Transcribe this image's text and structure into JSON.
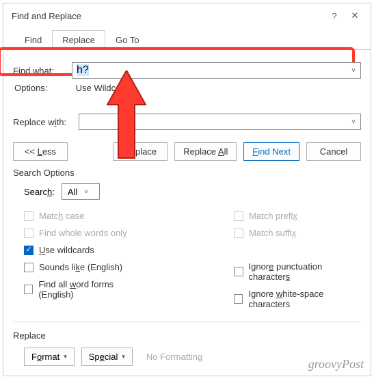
{
  "title": "Find and Replace",
  "tabs": {
    "find": "Find",
    "replace": "Replace",
    "goto": "Go To"
  },
  "fields": {
    "find_label": "Find what:",
    "find_value": "h?",
    "options_label": "Options:",
    "options_value": "Use Wildcards",
    "replace_label": "Replace with:",
    "replace_value": ""
  },
  "buttons": {
    "less": "<< Less",
    "replace": "Replace",
    "replace_all": "Replace All",
    "find_next": "Find Next",
    "cancel": "Cancel"
  },
  "search_options_title": "Search Options",
  "search_label": "Search:",
  "search_value": "All",
  "checks": {
    "match_case": "Match case",
    "whole_words": "Find whole words only",
    "use_wildcards": "Use wildcards",
    "sounds_like": "Sounds like (English)",
    "word_forms": "Find all word forms (English)",
    "match_prefix": "Match prefix",
    "match_suffix": "Match suffix",
    "ignore_punct": "Ignore punctuation characters",
    "ignore_ws": "Ignore white-space characters"
  },
  "replace_section_title": "Replace",
  "bottom": {
    "format": "Format",
    "special": "Special",
    "no_formatting": "No Formatting"
  },
  "watermark": "groovyPost"
}
